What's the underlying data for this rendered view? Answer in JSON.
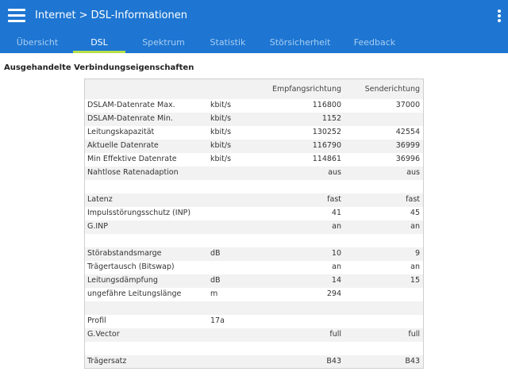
{
  "header": {
    "crumb_parent": "Internet",
    "crumb_separator": ">",
    "crumb_current": "DSL-Informationen"
  },
  "tabs": [
    {
      "label": "Übersicht",
      "active": false
    },
    {
      "label": "DSL",
      "active": true
    },
    {
      "label": "Spektrum",
      "active": false
    },
    {
      "label": "Statistik",
      "active": false
    },
    {
      "label": "Störsicherheit",
      "active": false
    },
    {
      "label": "Feedback",
      "active": false
    }
  ],
  "colors": {
    "header_bg": "#1e76d2",
    "active_tab_underline": "#b7e04a"
  },
  "section_title": "Ausgehandelte Verbindungseigenschaften",
  "table": {
    "col_empfang": "Empfangsrichtung",
    "col_sende": "Senderichtung",
    "rows": [
      {
        "label": "DSLAM-Datenrate Max.",
        "unit": "kbit/s",
        "empfang": "116800",
        "sende": "37000"
      },
      {
        "label": "DSLAM-Datenrate Min.",
        "unit": "kbit/s",
        "empfang": "1152",
        "sende": ""
      },
      {
        "label": "Leitungskapazität",
        "unit": "kbit/s",
        "empfang": "130252",
        "sende": "42554"
      },
      {
        "label": "Aktuelle Datenrate",
        "unit": "kbit/s",
        "empfang": "116790",
        "sende": "36999"
      },
      {
        "label": "Min Effektive Datenrate",
        "unit": "kbit/s",
        "empfang": "114861",
        "sende": "36996"
      },
      {
        "label": "Nahtlose Ratenadaption",
        "unit": "",
        "empfang": "aus",
        "sende": "aus"
      },
      {
        "label": "",
        "unit": "",
        "empfang": "",
        "sende": ""
      },
      {
        "label": "Latenz",
        "unit": "",
        "empfang": "fast",
        "sende": "fast"
      },
      {
        "label": "Impulsstörungsschutz (INP)",
        "unit": "",
        "empfang": "41",
        "sende": "45"
      },
      {
        "label": "G.INP",
        "unit": "",
        "empfang": "an",
        "sende": "an"
      },
      {
        "label": "",
        "unit": "",
        "empfang": "",
        "sende": ""
      },
      {
        "label": "Störabstandsmarge",
        "unit": "dB",
        "empfang": "10",
        "sende": "9"
      },
      {
        "label": "Trägertausch (Bitswap)",
        "unit": "",
        "empfang": "an",
        "sende": "an"
      },
      {
        "label": "Leitungsdämpfung",
        "unit": "dB",
        "empfang": "14",
        "sende": "15"
      },
      {
        "label": "ungefähre Leitungslänge",
        "unit": "m",
        "empfang": "294",
        "sende": ""
      },
      {
        "label": "",
        "unit": "",
        "empfang": "",
        "sende": ""
      },
      {
        "label": "Profil",
        "unit": "17a",
        "empfang": "",
        "sende": ""
      },
      {
        "label": "G.Vector",
        "unit": "",
        "empfang": "full",
        "sende": "full"
      },
      {
        "label": "",
        "unit": "",
        "empfang": "",
        "sende": ""
      },
      {
        "label": "Trägersatz",
        "unit": "",
        "empfang": "B43",
        "sende": "B43"
      }
    ]
  }
}
